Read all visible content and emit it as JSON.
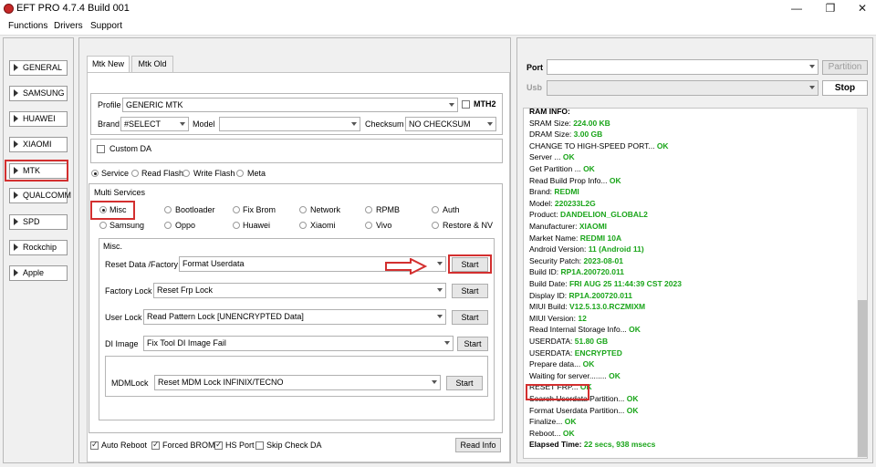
{
  "window": {
    "title": "EFT PRO 4.7.4 Build 001",
    "min": "—",
    "max": "❐",
    "close": "✕"
  },
  "menu": [
    "Functions",
    "Drivers",
    "Support"
  ],
  "sidebar": [
    "GENERAL",
    "SAMSUNG",
    "HUAWEI",
    "XIAOMI",
    "MTK",
    "QUALCOMM",
    "SPD",
    "Rockchip",
    "Apple"
  ],
  "tabs": [
    "Mtk New",
    "Mtk Old"
  ],
  "profile": {
    "label": "Profile",
    "value": "GENERIC MTK",
    "mth2": "MTH2"
  },
  "brand": {
    "label": "Brand",
    "value": "#SELECT"
  },
  "model": {
    "label": "Model",
    "value": ""
  },
  "checksum": {
    "label": "Checksum",
    "value": "NO CHECKSUM"
  },
  "custom_da": "Custom DA",
  "modes": [
    "Service",
    "Read Flash",
    "Write Flash",
    "Meta"
  ],
  "multi_services": {
    "title": "Multi Services",
    "row1": [
      "Misc",
      "Bootloader",
      "Fix Brom",
      "Network",
      "RPMB",
      "Auth"
    ],
    "row2": [
      "Samsung",
      "Oppo",
      "Huawei",
      "Xiaomi",
      "Vivo",
      "Restore & NV"
    ]
  },
  "misc": {
    "title": "Misc.",
    "rows": [
      {
        "label": "Reset Data /Factory",
        "value": "Format Userdata",
        "button": "Start"
      },
      {
        "label": "Factory Lock",
        "value": "Reset Frp Lock",
        "button": "Start"
      },
      {
        "label": "User Lock",
        "value": "Read Pattern Lock [UNENCRYPTED Data]",
        "button": "Start"
      },
      {
        "label": "DI Image",
        "value": "Fix Tool DI Image Fail",
        "button": "Start"
      },
      {
        "label": "MDMLock",
        "value": "Reset MDM Lock INFINIX/TECNO",
        "button": "Start"
      }
    ]
  },
  "bottom": {
    "auto_reboot": "Auto Reboot",
    "forced_brom": "Forced BROM",
    "hs_port": "HS Port",
    "skip_check_da": "Skip Check DA",
    "read_info": "Read Info"
  },
  "port": {
    "label": "Port",
    "value": "",
    "partition": "Partition",
    "usb_label": "Usb",
    "stop": "Stop"
  },
  "log": [
    {
      "text": "RAM INFO:"
    },
    {
      "text": "SRAM Size: ",
      "value": "224.00 KB"
    },
    {
      "text": "DRAM Size: ",
      "value": "3.00 GB"
    },
    {
      "text": "CHANGE TO HIGH-SPEED PORT... ",
      "ok": "OK"
    },
    {
      "text": "Server ... ",
      "ok": "OK"
    },
    {
      "text": "Get Partition ... ",
      "ok": "OK"
    },
    {
      "text": "Read Build Prop Info... ",
      "ok": "OK"
    },
    {
      "text": " Brand: ",
      "value": "REDMI"
    },
    {
      "text": " Model: ",
      "value": "220233L2G"
    },
    {
      "text": " Product: ",
      "value": "DANDELION_GLOBAL2"
    },
    {
      "text": " Manufacturer: ",
      "value": "XIAOMI"
    },
    {
      "text": " Market Name: ",
      "value": "REDMI 10A"
    },
    {
      "text": " Android Version: ",
      "value": "11 (Android 11)"
    },
    {
      "text": " Security Patch: ",
      "value": "2023-08-01"
    },
    {
      "text": " Build ID: ",
      "value": "RP1A.200720.011"
    },
    {
      "text": " Build Date: ",
      "value": "FRI AUG 25 11:44:39 CST 2023"
    },
    {
      "text": " Display ID: ",
      "value": "RP1A.200720.011"
    },
    {
      "text": " MIUI Build: ",
      "value": "V12.5.13.0.RCZMIXM"
    },
    {
      "text": " MIUI Version: ",
      "value": "12"
    },
    {
      "text": "Read Internal Storage Info... ",
      "ok": "OK"
    },
    {
      "text": "USERDATA: ",
      "value": "51.80 GB"
    },
    {
      "text": "USERDATA: ",
      "value": "ENCRYPTED"
    },
    {
      "text": "Prepare data... ",
      "ok": "OK"
    },
    {
      "text": "Waiting for server........ ",
      "ok": "OK"
    },
    {
      "text": "RESET FRP... ",
      "ok": "OK"
    },
    {
      "text": "Search Userdata Partition... ",
      "ok": "OK"
    },
    {
      "text": "Format Userdata Partition... ",
      "ok": "OK"
    },
    {
      "text": "Finalize... ",
      "ok": "OK"
    },
    {
      "text": "Reboot... ",
      "ok": "OK"
    },
    {
      "text": "Elapsed Time: ",
      "value": "22 secs, 938 msecs"
    }
  ],
  "colors": {
    "ok": "#1aa51a",
    "highlight": "#d32f2f"
  }
}
